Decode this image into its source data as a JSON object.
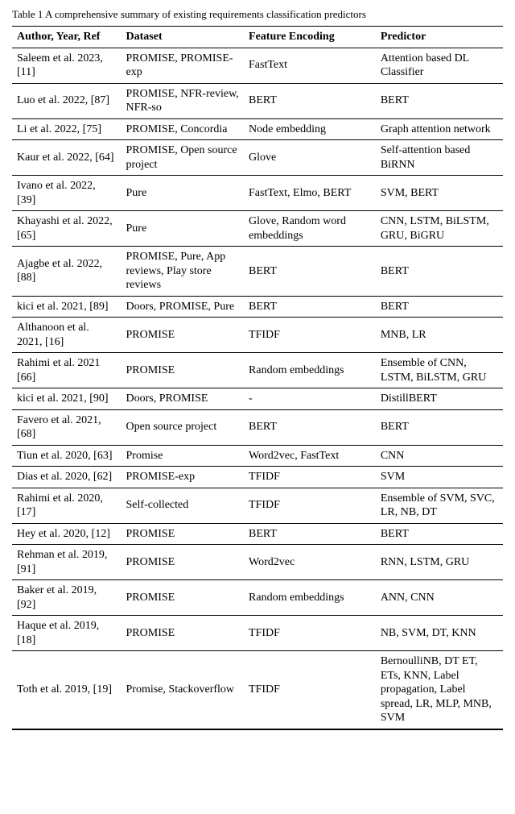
{
  "caption": "Table 1  A comprehensive summary of existing requirements classification predictors",
  "headers": {
    "author": "Author, Year, Ref",
    "dataset": "Dataset",
    "feature": "Feature Encoding",
    "predictor": "Predictor"
  },
  "rows": [
    {
      "author": "Saleem et al. 2023, ",
      "ref": "[11]",
      "dataset": "PROMISE, PROMISE-exp",
      "feature": "FastText",
      "predictor": "Attention based DL Classifier"
    },
    {
      "author": "Luo et al. 2022, ",
      "ref": "[87]",
      "dataset": "PROMISE, NFR-review, NFR-so",
      "feature": "BERT",
      "predictor": "BERT"
    },
    {
      "author": "Li et al. 2022, ",
      "ref": "[75]",
      "dataset": "PROMISE, Concordia",
      "feature": "Node embedding",
      "predictor": "Graph attention network"
    },
    {
      "author": "Kaur et al. 2022, ",
      "ref": "[64]",
      "dataset": "PROMISE, Open source project",
      "feature": "Glove",
      "predictor": "Self-attention based BiRNN"
    },
    {
      "author": "Ivano et al. 2022, ",
      "ref": "[39]",
      "dataset": "Pure",
      "feature": "FastText, Elmo, BERT",
      "predictor": "SVM, BERT"
    },
    {
      "author": "Khayashi et al. 2022, ",
      "ref": "[65]",
      "dataset": "Pure",
      "feature": "Glove, Random word embeddings",
      "predictor": "CNN, LSTM, BiLSTM, GRU, BiGRU"
    },
    {
      "author": "Ajagbe et al. 2022, ",
      "ref": "[88]",
      "dataset": "PROMISE, Pure, App reviews, Play store reviews",
      "feature": "BERT",
      "predictor": "BERT"
    },
    {
      "author": "kici et al. 2021, ",
      "ref": "[89]",
      "dataset": "Doors, PROMISE, Pure",
      "feature": "BERT",
      "predictor": "BERT"
    },
    {
      "author": "Althanoon et al. 2021, ",
      "ref": "[16]",
      "dataset": "PROMISE",
      "feature": "TFIDF",
      "predictor": "MNB, LR"
    },
    {
      "author": "Rahimi et al. 2021 ",
      "ref": "[66]",
      "dataset": "PROMISE",
      "feature": "Random embeddings",
      "predictor": "Ensemble of CNN, LSTM, BiLSTM, GRU"
    },
    {
      "author": "kici et al. 2021, ",
      "ref": "[90]",
      "dataset": "Doors, PROMISE",
      "feature": "-",
      "predictor": "DistillBERT"
    },
    {
      "author": "Favero et al. 2021, ",
      "ref": "[68]",
      "dataset": "Open source project",
      "feature": "BERT",
      "predictor": "BERT"
    },
    {
      "author": "Tiun et al. 2020, ",
      "ref": "[63]",
      "dataset": "Promise",
      "feature": "Word2vec, FastText",
      "predictor": "CNN"
    },
    {
      "author": "Dias et al. 2020, ",
      "ref": "[62]",
      "dataset": "PROMISE-exp",
      "feature": "TFIDF",
      "predictor": "SVM"
    },
    {
      "author": "Rahimi et al. 2020, ",
      "ref": "[17]",
      "dataset": "Self-collected",
      "feature": "TFIDF",
      "predictor": "Ensemble of SVM, SVC, LR, NB, DT"
    },
    {
      "author": "Hey et al. 2020, ",
      "ref": "[12]",
      "dataset": "PROMISE",
      "feature": "BERT",
      "predictor": "BERT"
    },
    {
      "author": "Rehman et al. 2019, ",
      "ref": "[91]",
      "dataset": "PROMISE",
      "feature": "Word2vec",
      "predictor": "RNN, LSTM, GRU"
    },
    {
      "author": "Baker et al. 2019, ",
      "ref": "[92]",
      "dataset": "PROMISE",
      "feature": "Random embeddings",
      "predictor": "ANN, CNN"
    },
    {
      "author": "Haque et al. 2019, ",
      "ref": "[18]",
      "dataset": "PROMISE",
      "feature": "TFIDF",
      "predictor": "NB, SVM, DT, KNN"
    },
    {
      "author": "Toth et al. 2019, ",
      "ref": "[19]",
      "dataset": "Promise, Stackoverflow",
      "feature": "TFIDF",
      "predictor": "BernoulliNB, DT ET, ETs, KNN, Label propagation, Label spread, LR, MLP, MNB, SVM"
    }
  ]
}
